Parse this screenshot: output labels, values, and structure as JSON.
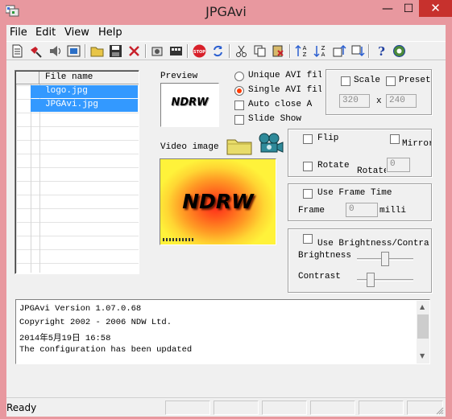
{
  "window": {
    "title": "JPGAvi"
  },
  "menu": [
    "File",
    "Edit",
    "View",
    "Help"
  ],
  "toolbar_icons": [
    "new-icon",
    "pin-icon",
    "speaker-icon",
    "film-icon",
    "open-folder-icon",
    "save-icon",
    "delete-icon",
    "gear-icon",
    "filmstrip-icon",
    "stop-icon",
    "refresh-icon",
    "cut-icon",
    "copy-icon",
    "paste-icon",
    "sort-asc-icon",
    "sort-desc-icon",
    "move-up-icon",
    "move-down-icon",
    "help-icon",
    "info-icon"
  ],
  "file_list": {
    "header": "File name",
    "files": [
      "logo.jpg",
      "JPGAvi.jpg"
    ]
  },
  "preview": {
    "label": "Preview",
    "logo_text": "NDRW"
  },
  "options": {
    "unique_avi": "Unique AVI file",
    "single_avi": "Single AVI file",
    "auto_close": "Auto close A",
    "slide_show": "Slide Show",
    "single_selected": true
  },
  "video": {
    "label": "Video image",
    "logo_text": "NDRW"
  },
  "scale": {
    "scale_label": "Scale",
    "preset_label": "Preset",
    "width": "320",
    "x": "x",
    "height": "240"
  },
  "flip": {
    "flip_label": "Flip",
    "mirror_label": "Mirror",
    "rotate_label": "Rotate",
    "rotate2_label": "Rotate",
    "rotate_value": "0"
  },
  "frame": {
    "use_label": "Use Frame Time",
    "frame_label": "Frame",
    "value": "0",
    "unit": "milli"
  },
  "brightness": {
    "use_label": "Use Brightness/Contra",
    "brightness_label": "Brightness",
    "contrast_label": "Contrast",
    "brightness_level": 0.5,
    "contrast_level": 0.2
  },
  "log": [
    "JPGAvi Version   1.07.0.68",
    "Copyright  2002 - 2006 NDW Ltd.",
    "2014年5月19日  16:58",
    "The configuration has been updated"
  ],
  "status": {
    "text": "Ready"
  }
}
